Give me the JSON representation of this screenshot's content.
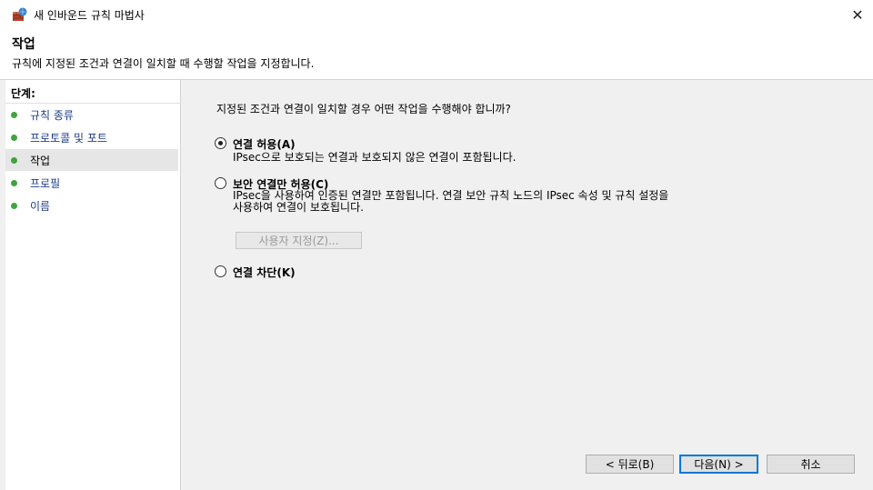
{
  "window": {
    "title": "새 인바운드 규칙 마법사",
    "close_glyph": "✕"
  },
  "header": {
    "title": "작업",
    "description": "규칙에 지정된 조건과 연결이 일치할 때 수행할 작업을 지정합니다."
  },
  "steps": {
    "heading": "단계:",
    "items": [
      {
        "label": "규칙 종류"
      },
      {
        "label": "프로토콜 및 포트"
      },
      {
        "label": "작업"
      },
      {
        "label": "프로필"
      },
      {
        "label": "이름"
      }
    ],
    "active_index": 2
  },
  "content": {
    "question": "지정된 조건과 연결이 일치할 경우 어떤 작업을 수행해야 합니까?",
    "options": [
      {
        "label": "연결 허용(A)",
        "description": "IPsec으로 보호되는 연결과 보호되지 않은 연결이 포함됩니다.",
        "selected": true
      },
      {
        "label": "보안 연결만 허용(C)",
        "description_line1": "IPsec을 사용하여 인증된 연결만 포함됩니다. 연결 보안 규칙 노드의 IPsec 속성 및 규칙 설정을",
        "description_line2": "사용하여 연결이 보호됩니다.",
        "selected": false
      },
      {
        "label": "연결 차단(K)",
        "selected": false
      }
    ],
    "customize_button": "사용자 지정(Z)..."
  },
  "footer": {
    "back_button": "< 뒤로(B)",
    "next_button": "다음(N) >",
    "cancel_button": "취소"
  },
  "colors": {
    "step_dot": "#3ca63c",
    "link_text": "#1f3c88",
    "default_button_border": "#0078d7"
  }
}
